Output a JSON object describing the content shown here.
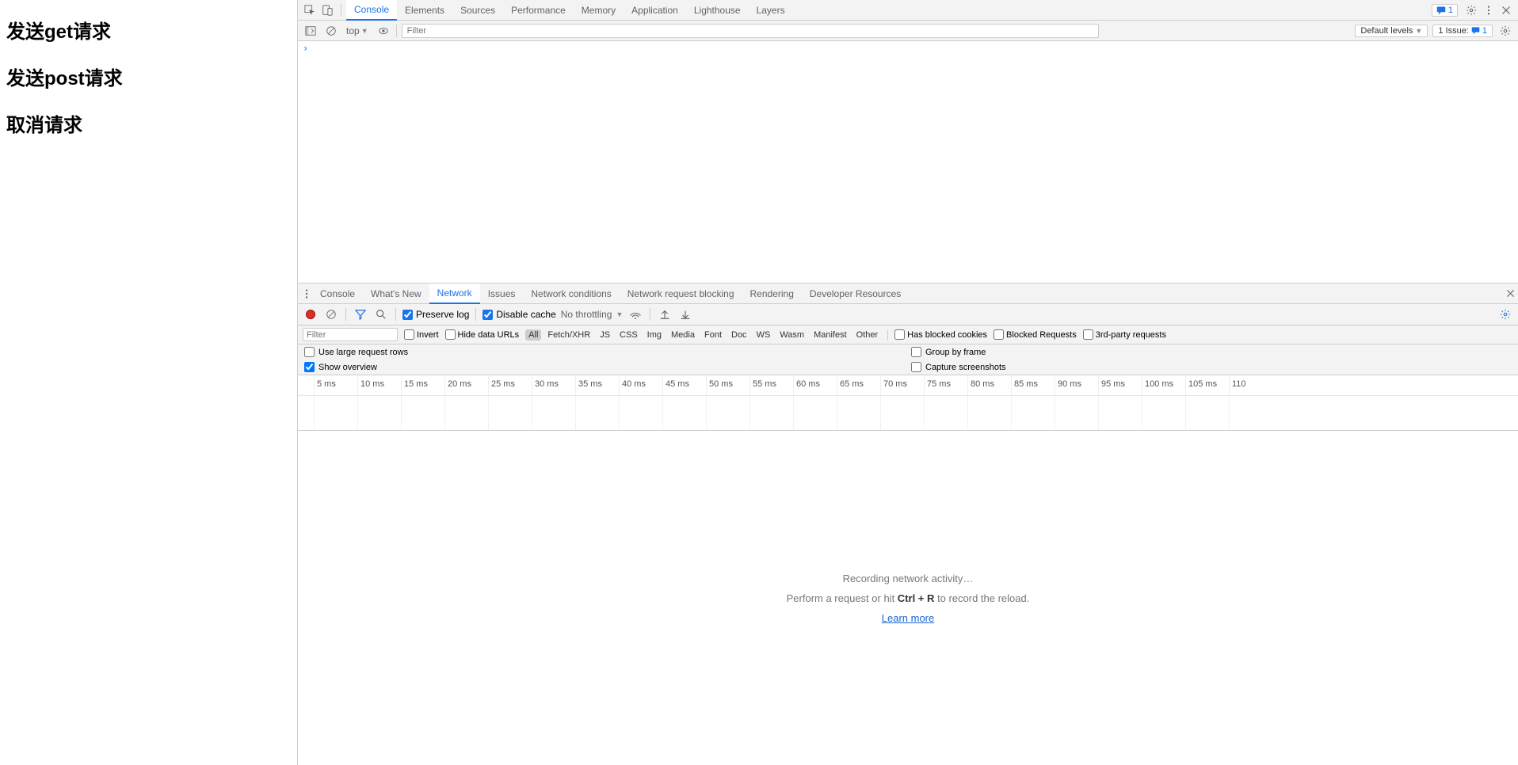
{
  "page": {
    "h1": "发送get请求",
    "h2": "发送post请求",
    "h3": "取消请求"
  },
  "topbar": {
    "tabs": [
      "Console",
      "Elements",
      "Sources",
      "Performance",
      "Memory",
      "Application",
      "Lighthouse",
      "Layers"
    ],
    "active": "Console",
    "issue_count": "1"
  },
  "console_toolbar": {
    "context": "top",
    "filter_placeholder": "Filter",
    "levels": "Default levels",
    "issues_label": "1 Issue:",
    "issues_count": "1"
  },
  "console": {
    "prompt": "›"
  },
  "drawer_tabs": {
    "items": [
      "Console",
      "What's New",
      "Network",
      "Issues",
      "Network conditions",
      "Network request blocking",
      "Rendering",
      "Developer Resources"
    ],
    "active": "Network"
  },
  "net_toolbar": {
    "preserve_log": "Preserve log",
    "disable_cache": "Disable cache",
    "throttling": "No throttling"
  },
  "net_filter": {
    "placeholder": "Filter",
    "invert": "Invert",
    "hide_data": "Hide data URLs",
    "types": [
      "All",
      "Fetch/XHR",
      "JS",
      "CSS",
      "Img",
      "Media",
      "Font",
      "Doc",
      "WS",
      "Wasm",
      "Manifest",
      "Other"
    ],
    "active_type": "All",
    "blocked_cookies": "Has blocked cookies",
    "blocked_requests": "Blocked Requests",
    "third_party": "3rd-party requests"
  },
  "net_opts": {
    "large_rows": "Use large request rows",
    "group_frame": "Group by frame",
    "show_overview": "Show overview",
    "capture_ss": "Capture screenshots"
  },
  "timeline": {
    "ticks": [
      "5 ms",
      "10 ms",
      "15 ms",
      "20 ms",
      "25 ms",
      "30 ms",
      "35 ms",
      "40 ms",
      "45 ms",
      "50 ms",
      "55 ms",
      "60 ms",
      "65 ms",
      "70 ms",
      "75 ms",
      "80 ms",
      "85 ms",
      "90 ms",
      "95 ms",
      "100 ms",
      "105 ms",
      "110"
    ]
  },
  "empty": {
    "line1": "Recording network activity…",
    "line2_a": "Perform a request or hit ",
    "line2_b": "Ctrl + R",
    "line2_c": " to record the reload.",
    "learn": "Learn more"
  }
}
